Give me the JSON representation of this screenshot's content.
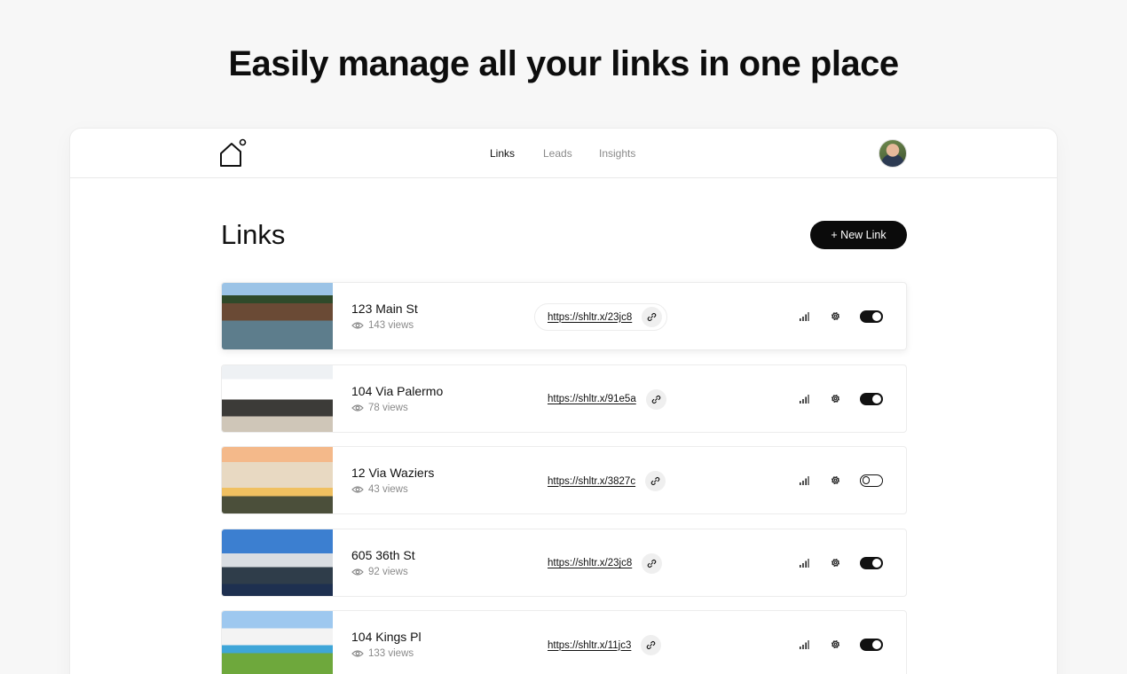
{
  "hero": {
    "headline": "Easily manage all your links in one place"
  },
  "nav": {
    "items": [
      {
        "label": "Links",
        "active": true
      },
      {
        "label": "Leads",
        "active": false
      },
      {
        "label": "Insights",
        "active": false
      }
    ]
  },
  "page": {
    "title": "Links",
    "new_link_label": "+ New Link"
  },
  "links": [
    {
      "name": "123 Main St",
      "views": "143 views",
      "url": "https://shltr.x/23jc8",
      "enabled": true
    },
    {
      "name": "104 Via Palermo",
      "views": "78 views",
      "url": "https://shltr.x/91e5a",
      "enabled": true
    },
    {
      "name": "12 Via Waziers",
      "views": "43 views",
      "url": "https://shltr.x/3827c",
      "enabled": false
    },
    {
      "name": "605 36th St",
      "views": "92 views",
      "url": "https://shltr.x/23jc8",
      "enabled": true
    },
    {
      "name": "104 Kings Pl",
      "views": "133 views",
      "url": "https://shltr.x/11jc3",
      "enabled": true
    }
  ],
  "colors": {
    "accent": "#0b0b0b",
    "muted": "#8a8a8a",
    "border": "#ececec"
  },
  "icons": [
    "house-logo-icon",
    "eye-icon",
    "link-icon",
    "bar-chart-icon",
    "gear-icon"
  ]
}
